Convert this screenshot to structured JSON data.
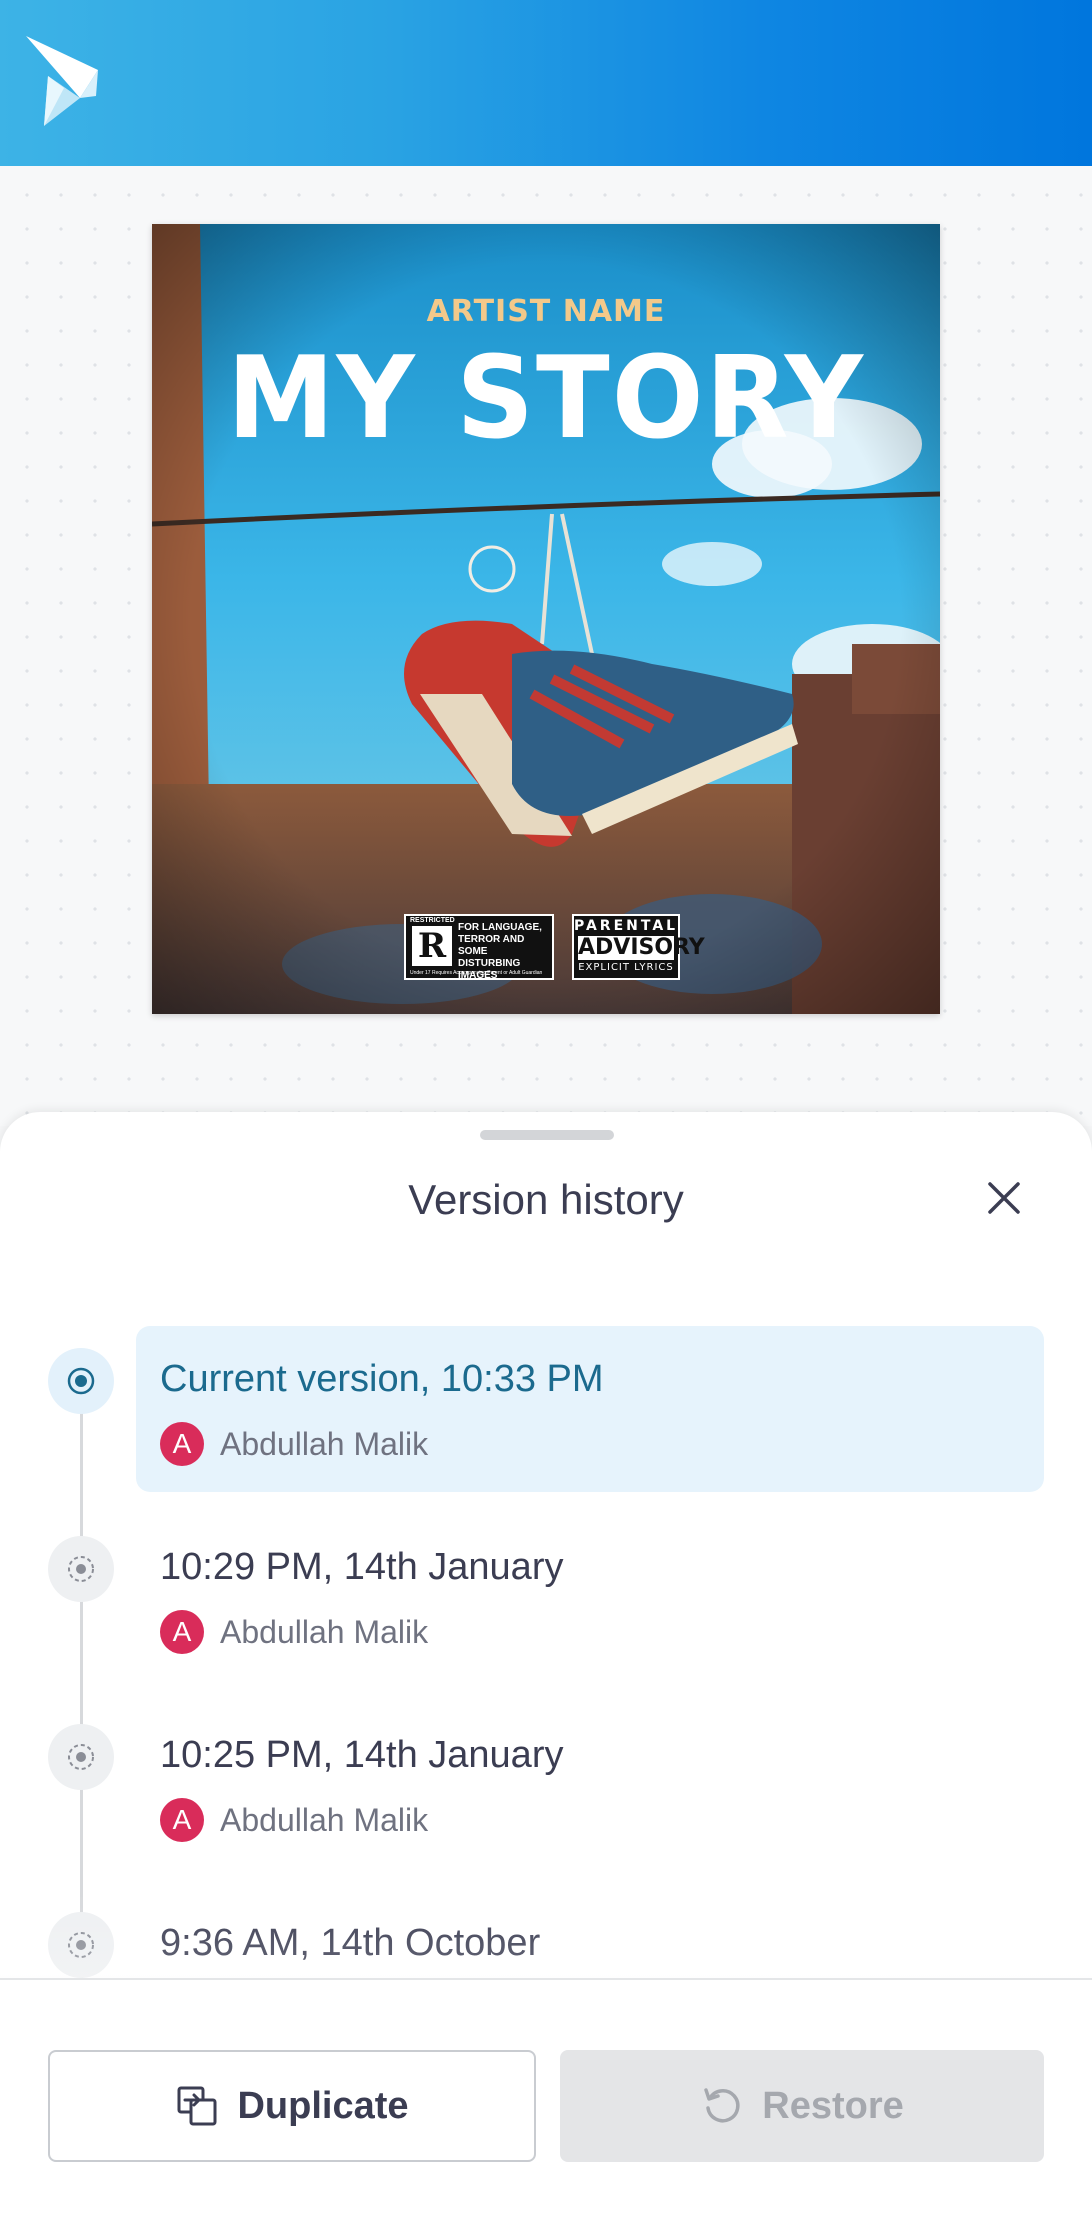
{
  "header": {
    "logo_icon": "app-logo-icon"
  },
  "artwork": {
    "artist": "ARTIST NAME",
    "title": "MY STORY",
    "rating": {
      "restricted": "RESTRICTED",
      "letter": "R",
      "text": "FOR LANGUAGE, TERROR AND SOME DISTURBING IMAGES",
      "under": "Under 17 Requires Accompanying Parent or Adult Guardian"
    },
    "advisory": {
      "line1": "PARENTAL",
      "line2": "ADVISORY",
      "line3": "EXPLICIT LYRICS"
    }
  },
  "sheet": {
    "title": "Version history",
    "close_icon": "close-icon",
    "versions": [
      {
        "time": "Current version, 10:33 PM",
        "author": "Abdullah Malik",
        "initial": "A",
        "current": true
      },
      {
        "time": "10:29 PM, 14th January",
        "author": "Abdullah Malik",
        "initial": "A",
        "current": false
      },
      {
        "time": "10:25 PM, 14th January",
        "author": "Abdullah Malik",
        "initial": "A",
        "current": false
      },
      {
        "time": "9:36 AM, 14th October",
        "author": "",
        "initial": "",
        "current": false
      }
    ]
  },
  "footer": {
    "duplicate_label": "Duplicate",
    "restore_label": "Restore"
  },
  "colors": {
    "header_gradient_start": "#3db3e6",
    "header_gradient_end": "#0076dd",
    "current_version_bg": "#e6f3fc",
    "current_version_text": "#1b6a8e",
    "avatar": "#d92c5a"
  }
}
